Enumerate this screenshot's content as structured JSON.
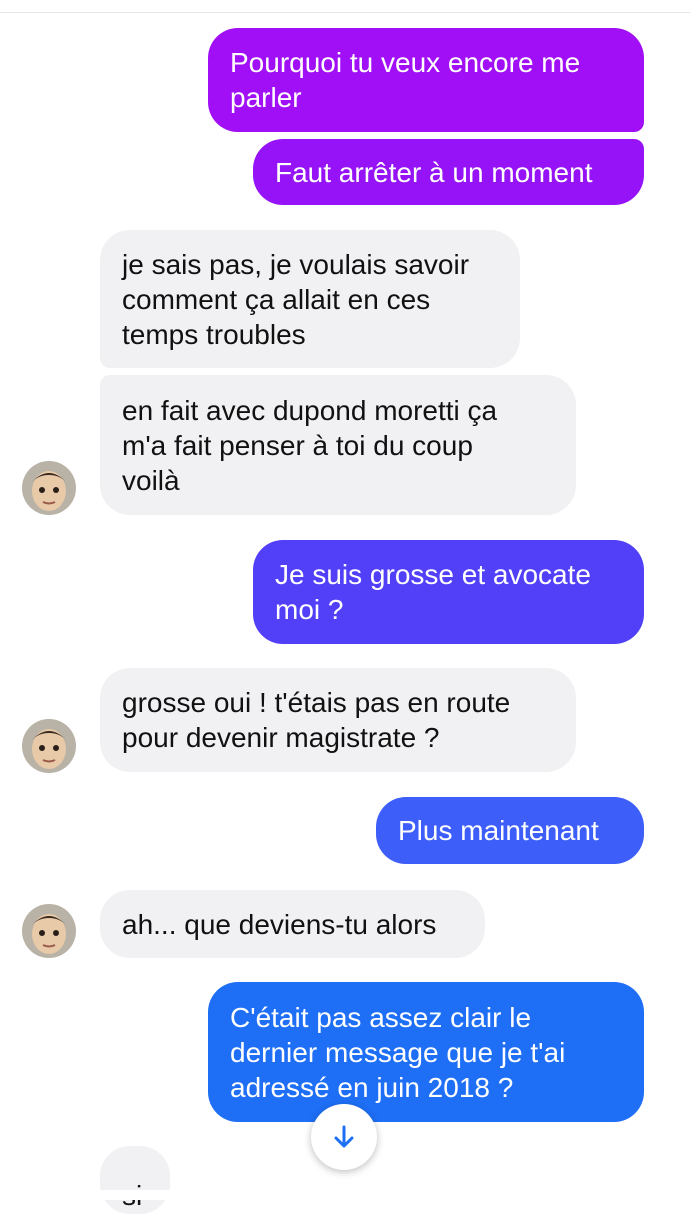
{
  "messages": [
    {
      "text": "Pourquoi tu veux encore me\nparler",
      "color": "#a00ff5"
    },
    {
      "text": "Faut arrêter à un moment",
      "color": "#9513f6"
    },
    {
      "text": "je sais pas, je voulais savoir\ncomment ça allait en ces\ntemps troubles"
    },
    {
      "text": "en fait avec dupond moretti ça\nm'a fait penser à toi du coup\nvoilà"
    },
    {
      "text": "Je suis grosse et avocate\nmoi ?",
      "color": "#5240f8"
    },
    {
      "text": "grosse oui ! t'étais pas en route\npour devenir magistrate ?"
    },
    {
      "text": "Plus maintenant",
      "color": "#3d5ef8"
    },
    {
      "text": "ah... que deviens-tu alors"
    },
    {
      "text": "C'était pas assez clair le\ndernier message que je t'ai\nadressé en juin 2018 ?",
      "color": "#1e6ff6"
    },
    {
      "text": "si"
    }
  ],
  "scroll_button": {
    "icon": "arrow-down-icon",
    "color": "#1e6ff6"
  },
  "contact_avatar": {
    "icon": "contact-avatar"
  }
}
